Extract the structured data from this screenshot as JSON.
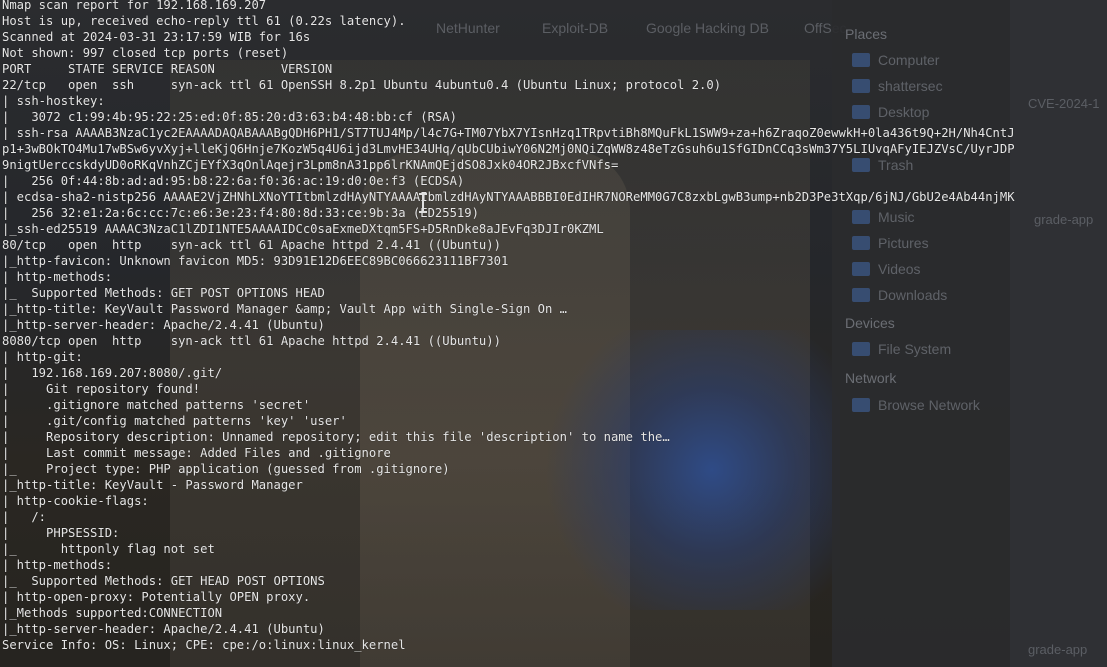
{
  "terminal": {
    "lines": [
      "Nmap scan report for 192.168.169.207",
      "Host is up, received echo-reply ttl 61 (0.22s latency).",
      "Scanned at 2024-03-31 23:17:59 WIB for 16s",
      "Not shown: 997 closed tcp ports (reset)",
      "PORT     STATE SERVICE REASON         VERSION",
      "22/tcp   open  ssh     syn-ack ttl 61 OpenSSH 8.2p1 Ubuntu 4ubuntu0.4 (Ubuntu Linux; protocol 2.0)",
      "| ssh-hostkey:",
      "|   3072 c1:99:4b:95:22:25:ed:0f:85:20:d3:63:b4:48:bb:cf (RSA)",
      "| ssh-rsa AAAAB3NzaC1yc2EAAAADAQABAAABgQDH6PH1/ST7TUJ4Mp/l4c7G+TM07YbX7YIsnHzq1TRpvtiBh8MQuFkL1SWW9+za+h6ZraqoZ0ewwkH+0la436t9Q+2H/Nh4CntJ",
      "p1+3wBOkTO4Mu17wBSw6yvXyj+lleKjQ6Hnje7KozW5q4U6ijd3LmvHE34UHq/qUbCUbiwY06N2Mj0NQiZqWW8z48eTzGsuh6u1SfGIDnCCq3sWm37Y5LIUvqAFyIEJZVsC/UyrJDP",
      "9nigtUerccskdyUD0oRKqVnhZCjEYfX3qOnlAqejr3Lpm8nA31pp6lrKNAmQEjdSO8Jxk04OR2JBxcfVNfs=",
      "|   256 0f:44:8b:ad:ad:95:b8:22:6a:f0:36:ac:19:d0:0e:f3 (ECDSA)",
      "| ecdsa-sha2-nistp256 AAAAE2VjZHNhLXNoYTItbmlzdHAyNTYAAAAIbmlzdHAyNTYAAABBBI0EdIHR7NOReMM0G7C8zxbLgwB3ump+nb2D3Pe3tXqp/6jNJ/GbU2e4Ab44njMK",
      "|   256 32:e1:2a:6c:cc:7c:e6:3e:23:f4:80:8d:33:ce:9b:3a (ED25519)",
      "|_ssh-ed25519 AAAAC3NzaC1lZDI1NTE5AAAAIDCc0saExmeDXtqm5FS+D5RnDke8aJEvFq3DJIr0KZML",
      "80/tcp   open  http    syn-ack ttl 61 Apache httpd 2.4.41 ((Ubuntu))",
      "|_http-favicon: Unknown favicon MD5: 93D91E12D6EEC89BC066623111BF7301",
      "| http-methods:",
      "|_  Supported Methods: GET POST OPTIONS HEAD",
      "|_http-title: KeyVault Password Manager &amp; Vault App with Single-Sign On …",
      "|_http-server-header: Apache/2.4.41 (Ubuntu)",
      "8080/tcp open  http    syn-ack ttl 61 Apache httpd 2.4.41 ((Ubuntu))",
      "| http-git:",
      "|   192.168.169.207:8080/.git/",
      "|     Git repository found!",
      "|     .gitignore matched patterns 'secret'",
      "|     .git/config matched patterns 'key' 'user'",
      "|     Repository description: Unnamed repository; edit this file 'description' to name the…",
      "|     Last commit message: Added Files and .gitignore",
      "|_    Project type: PHP application (guessed from .gitignore)",
      "|_http-title: KeyVault - Password Manager",
      "| http-cookie-flags:",
      "|   /:",
      "|     PHPSESSID:",
      "|_      httponly flag not set",
      "| http-methods:",
      "|_  Supported Methods: GET HEAD POST OPTIONS",
      "| http-open-proxy: Potentially OPEN proxy.",
      "|_Methods supported:CONNECTION",
      "|_http-server-header: Apache/2.4.41 (Ubuntu)",
      "Service Info: OS: Linux; CPE: cpe:/o:linux:linux_kernel"
    ]
  },
  "background": {
    "tabs": [
      "NetHunter",
      "Exploit-DB",
      "Google Hacking DB",
      "OffSec"
    ],
    "places_heading": "Places",
    "places": [
      "Computer",
      "shattersec",
      "Desktop",
      "Trash",
      "Music",
      "Pictures",
      "Videos",
      "Downloads"
    ],
    "devices_heading": "Devices",
    "devices": [
      "File System"
    ],
    "network_heading": "Network",
    "network": [
      "Browse Network"
    ],
    "files": [
      "CVE-2024-1",
      "grade-app",
      "grade-app"
    ]
  },
  "colors": {
    "text": "#e6e6e6",
    "accent_blue": "#2f4b86"
  }
}
